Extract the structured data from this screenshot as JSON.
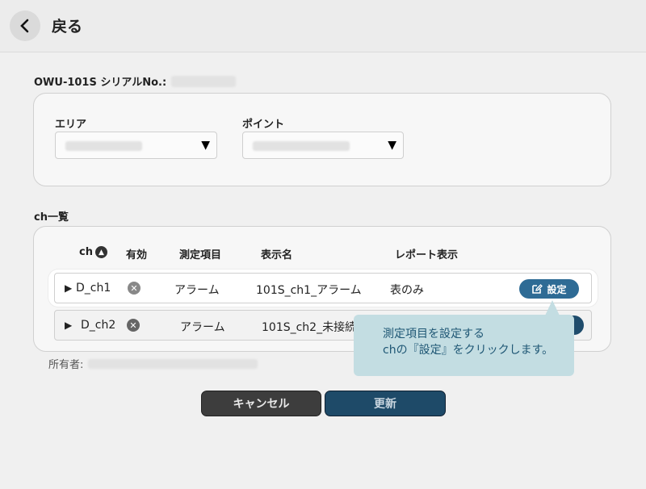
{
  "header": {
    "back_label": "戻る"
  },
  "device": {
    "serial_label": "OWU-101S シリアルNo.:"
  },
  "filters": {
    "area_label": "エリア",
    "point_label": "ポイント"
  },
  "channels": {
    "section_label": "ch一覧",
    "columns": {
      "ch": "ch",
      "enabled": "有効",
      "item": "測定項目",
      "display": "表示名",
      "report": "レポート表示"
    },
    "rows": [
      {
        "ch": "D_ch1",
        "item": "アラーム",
        "display": "101S_ch1_アラーム",
        "report": "表のみ",
        "button": "設定"
      },
      {
        "ch": "D_ch2",
        "item": "アラーム",
        "display": "101S_ch2_未接続"
      }
    ]
  },
  "owner": {
    "label": "所有者:"
  },
  "footer": {
    "cancel_label": "キャンセル",
    "update_label": "更新"
  },
  "tooltip": {
    "line1": "測定項目を設定する",
    "line2": "chの『設定』をクリックします。"
  },
  "icons": {
    "back": "chevron-left-icon",
    "sort": "chevron-up-icon",
    "disabled": "x-circle-icon",
    "expand": "triangle-right-icon",
    "edit": "edit-icon",
    "dropdown": "triangle-down-icon"
  },
  "colors": {
    "accent": "#2e6b95",
    "tooltip_bg": "#c3dde2",
    "tooltip_text": "#1e5674"
  }
}
